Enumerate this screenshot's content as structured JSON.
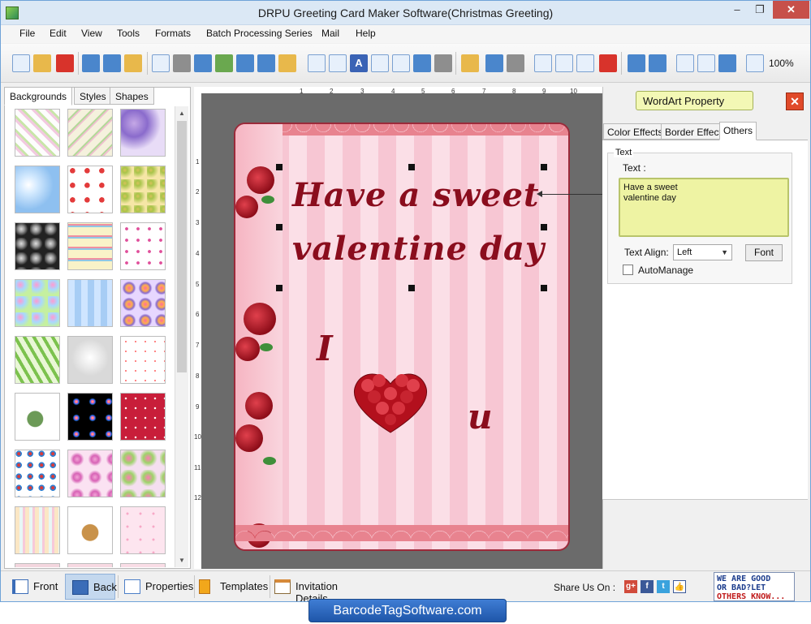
{
  "window": {
    "title": "DRPU Greeting Card Maker Software(Christmas Greeting)",
    "controls": {
      "minimize": "–",
      "maximize": "❐",
      "close": "✕"
    }
  },
  "menu": [
    "File",
    "Edit",
    "View",
    "Tools",
    "Formats",
    "Batch Processing Series",
    "Mail",
    "Help"
  ],
  "toolbar": {
    "zoom": "100%"
  },
  "left_tabs": [
    "Backgrounds",
    "Styles",
    "Shapes"
  ],
  "ruler": {
    "top": [
      "1",
      "2",
      "3",
      "4",
      "5",
      "6",
      "7",
      "8",
      "9",
      "10"
    ],
    "left": [
      "1",
      "2",
      "3",
      "4",
      "5",
      "6",
      "7",
      "8",
      "9",
      "10",
      "11",
      "12"
    ]
  },
  "card": {
    "line1": "Have a sweet",
    "line2": "valentine day",
    "letter_i": "I",
    "letter_u": "u"
  },
  "right_panel": {
    "wordart_button": "WordArt Property",
    "close_label": "✕",
    "tabs": [
      "Color Effects",
      "Border Effect",
      "Others"
    ],
    "group_title": "Text",
    "text_label": "Text :",
    "text_value": "Have a sweet\nvalentine day",
    "align_label": "Text Align:",
    "align_value": "Left",
    "font_button": "Font",
    "automanage_label": "AutoManage"
  },
  "bottom": {
    "front": "Front",
    "back": "Back",
    "properties": "Properties",
    "templates": "Templates",
    "invitation": "Invitation Details",
    "share_label": "Share Us On :",
    "badge_l1": "WE ARE GOOD",
    "badge_l2": "OR BAD?LET",
    "badge_l3": "OTHERS KNOW..."
  },
  "footer": {
    "banner": "BarcodeTagSoftware.com"
  },
  "colors": {
    "accent": "#2f65b5",
    "card_text": "#8a0d1d",
    "wordart_bg": "#f3f8b5"
  }
}
